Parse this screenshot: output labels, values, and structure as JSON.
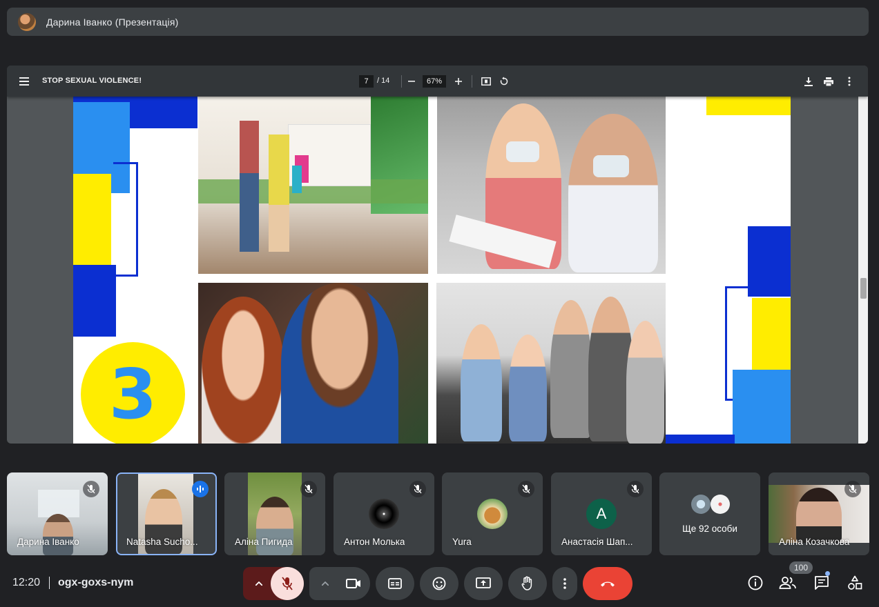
{
  "presenter": {
    "name": "Дарина Іванко (Презентація)"
  },
  "pdf": {
    "title": "STOP SEXUAL VIOLENCE!",
    "page_current": "7",
    "page_total": "/ 14",
    "zoom": "67%",
    "slide_number": "3"
  },
  "participants": [
    {
      "name": "Дарина Іванко",
      "muted": true
    },
    {
      "name": "Natasha Sucho...",
      "speaking": true
    },
    {
      "name": "Аліна Пигида",
      "muted": true
    },
    {
      "name": "Антон Молька",
      "muted": true
    },
    {
      "name": "Yura",
      "muted": true
    },
    {
      "name": "Анастасія Шап...",
      "muted": true,
      "initial": "A"
    },
    {
      "name": "Ще 92 особи"
    },
    {
      "name": "Аліна Козачкова",
      "muted": true
    }
  ],
  "footer": {
    "time": "12:20",
    "meeting_code": "ogx-goxs-nym",
    "people_count": "100"
  },
  "colors": {
    "background": "#202124",
    "panel": "#3c4043",
    "mic_off_bg": "#f9dedc",
    "end_call": "#ea4335",
    "speaking_border": "#8ab4f8",
    "slide_blue": "#2a8ff0",
    "slide_dark_blue": "#0b2fd1",
    "slide_yellow": "#ffed00"
  }
}
